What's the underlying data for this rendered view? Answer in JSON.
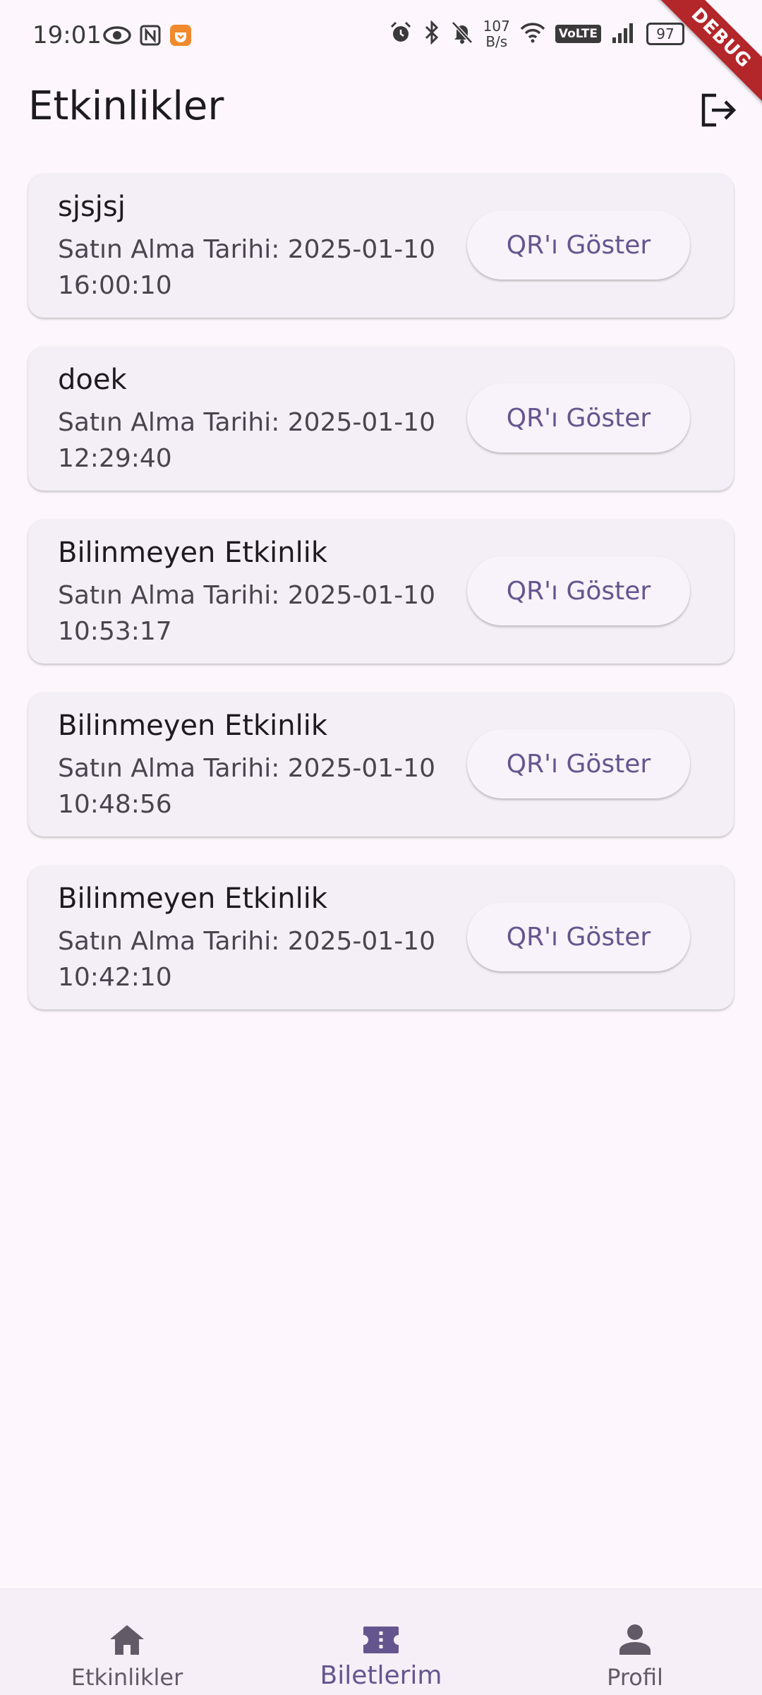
{
  "status_bar": {
    "time": "19:01",
    "speed_value": "107",
    "speed_unit": "B/s",
    "network_label": "VoLTE",
    "battery": "97",
    "debug_label": "DEBUG",
    "icons": [
      "eye-icon",
      "nfc-icon",
      "app-notification-icon",
      "alarm-icon",
      "bluetooth-icon",
      "mute-icon",
      "wifi-icon",
      "signal-icon",
      "battery-icon"
    ]
  },
  "app_bar": {
    "title": "Etkinlikler",
    "action_icon": "logout-icon"
  },
  "tickets": [
    {
      "name": "sjsjsj",
      "date_line1": "Satın Alma Tarihi: 2025-01-10",
      "date_line2": "16:00:10",
      "button_label": "QR'ı Göster"
    },
    {
      "name": "doek",
      "date_line1": "Satın Alma Tarihi: 2025-01-10",
      "date_line2": "12:29:40",
      "button_label": "QR'ı Göster"
    },
    {
      "name": "Bilinmeyen Etkinlik",
      "date_line1": "Satın Alma Tarihi: 2025-01-10",
      "date_line2": "10:53:17",
      "button_label": "QR'ı Göster"
    },
    {
      "name": "Bilinmeyen Etkinlik",
      "date_line1": "Satın Alma Tarihi: 2025-01-10",
      "date_line2": "10:48:56",
      "button_label": "QR'ı Göster"
    },
    {
      "name": "Bilinmeyen Etkinlik",
      "date_line1": "Satın Alma Tarihi: 2025-01-10",
      "date_line2": "10:42:10",
      "button_label": "QR'ı Göster"
    }
  ],
  "bottom_nav": {
    "items": [
      {
        "label": "Etkinlikler",
        "icon": "home-icon",
        "active": false
      },
      {
        "label": "Biletlerim",
        "icon": "ticket-icon",
        "active": true
      },
      {
        "label": "Profil",
        "icon": "person-icon",
        "active": false
      }
    ]
  },
  "colors": {
    "background": "#fdf7fd",
    "card": "#f4eff6",
    "accent": "#65558f",
    "debug_banner": "#b3262a"
  }
}
